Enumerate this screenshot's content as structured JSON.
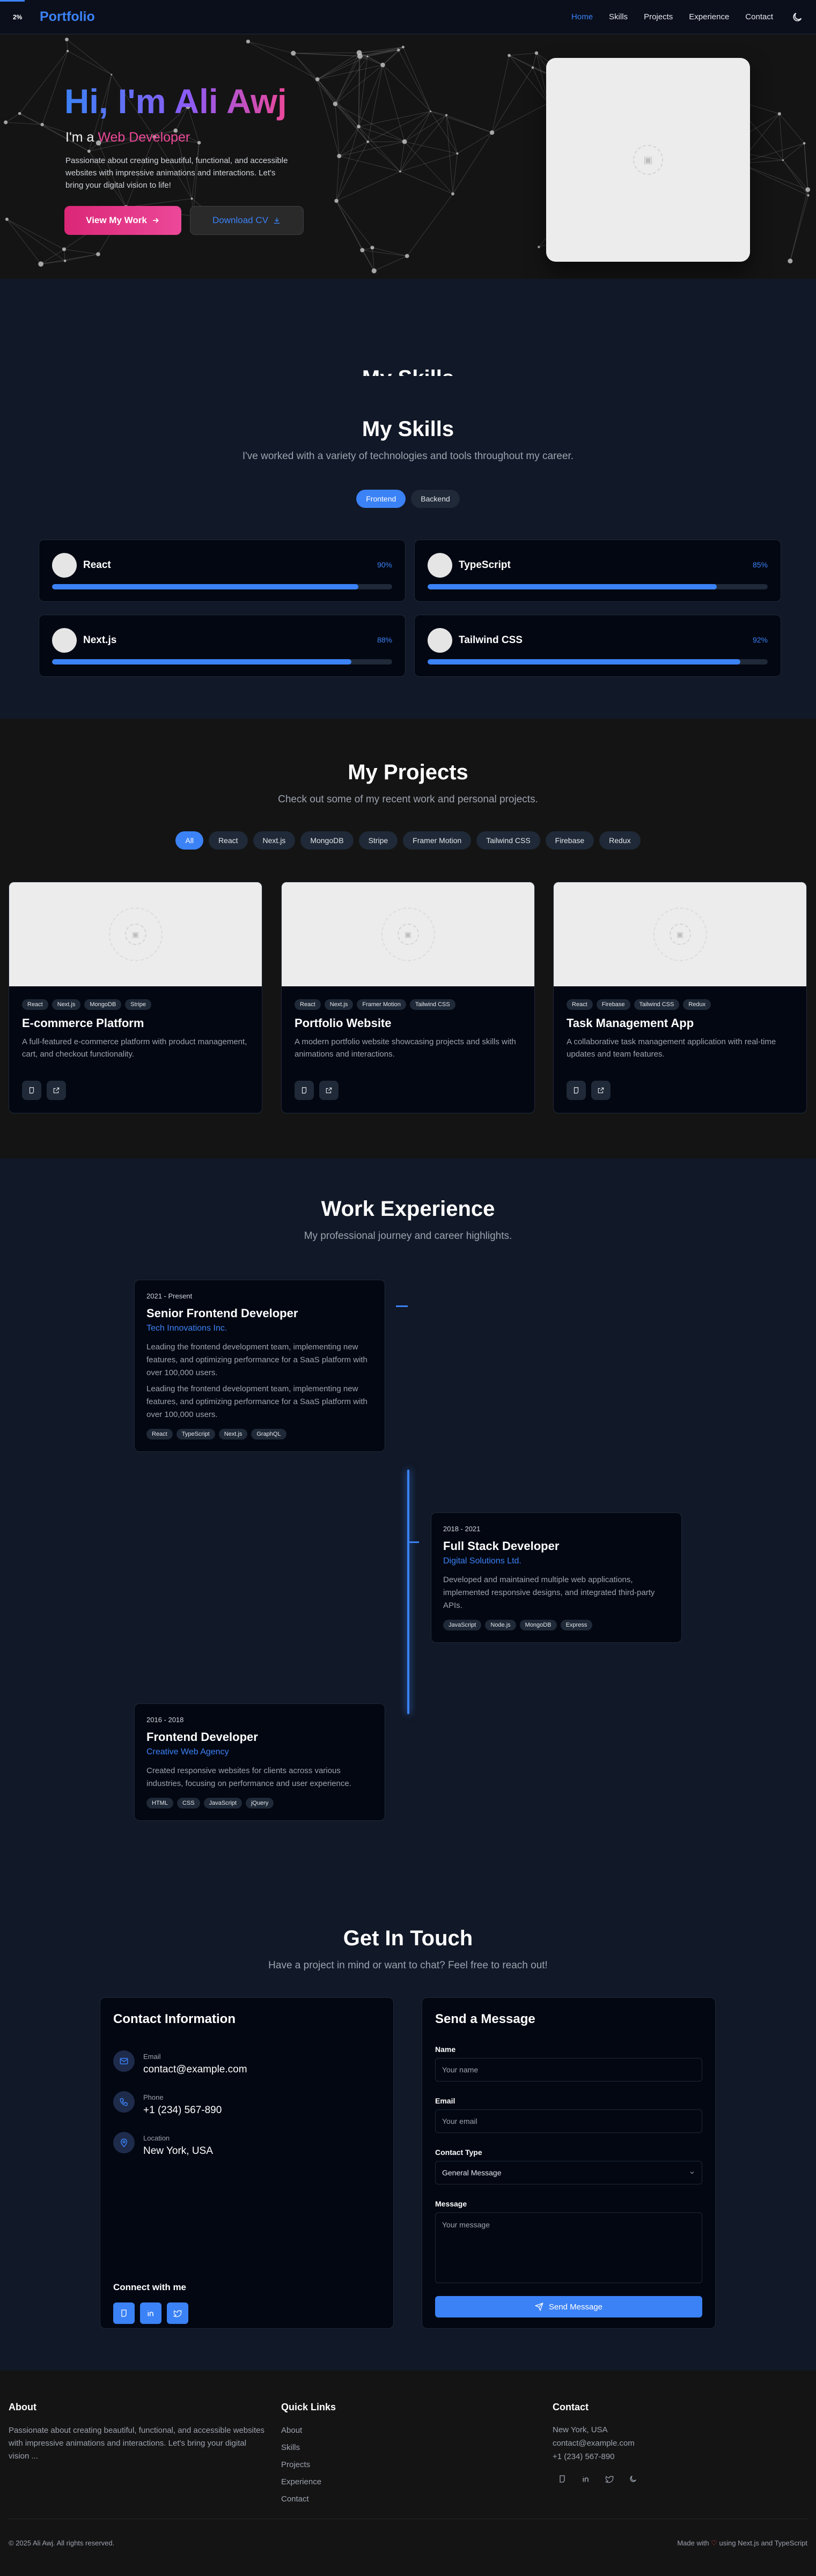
{
  "nav": {
    "scroll_percent": "2%",
    "brand": "Portfolio",
    "links": [
      "Home",
      "Skills",
      "Projects",
      "Experience",
      "Contact"
    ],
    "active": "Home"
  },
  "hero": {
    "title": "Hi, I'm Ali Awj",
    "role_prefix": "I'm a ",
    "role_highlight": "Web Developer",
    "description": "Passionate about creating beautiful, functional, and accessible websites with impressive animations and interactions. Let's bring your digital vision to life!",
    "primary_button": "View My Work",
    "secondary_button": "Download CV"
  },
  "skills": {
    "ghost_title": "My Skills",
    "title": "My Skills",
    "subtitle": "I've worked with a variety of technologies and tools throughout my career.",
    "tabs": [
      "Frontend",
      "Backend"
    ],
    "active_tab": "Frontend",
    "items": [
      {
        "name": "React",
        "percent_label": "90%",
        "level": 0.9
      },
      {
        "name": "TypeScript",
        "percent_label": "85%",
        "level": 0.85
      },
      {
        "name": "Next.js",
        "percent_label": "88%",
        "level": 0.88
      },
      {
        "name": "Tailwind CSS",
        "percent_label": "92%",
        "level": 0.92
      }
    ]
  },
  "projects": {
    "title": "My Projects",
    "subtitle": "Check out some of my recent work and personal projects.",
    "filters": [
      "All",
      "React",
      "Next.js",
      "MongoDB",
      "Stripe",
      "Framer Motion",
      "Tailwind CSS",
      "Firebase",
      "Redux"
    ],
    "active_filter": "All",
    "items": [
      {
        "tags": [
          "React",
          "Next.js",
          "MongoDB",
          "Stripe"
        ],
        "name": "E-commerce Platform",
        "description": "A full-featured e-commerce platform with product management, cart, and checkout functionality."
      },
      {
        "tags": [
          "React",
          "Next.js",
          "Framer Motion",
          "Tailwind CSS"
        ],
        "name": "Portfolio Website",
        "description": "A modern portfolio website showcasing projects and skills with animations and interactions."
      },
      {
        "tags": [
          "React",
          "Firebase",
          "Tailwind CSS",
          "Redux"
        ],
        "name": "Task Management App",
        "description": "A collaborative task management application with real-time updates and team features."
      }
    ]
  },
  "experience": {
    "title": "Work Experience",
    "subtitle": "My professional journey and career highlights.",
    "items": [
      {
        "period": "2021 - Present",
        "role": "Senior Frontend Developer",
        "company": "Tech Innovations Inc.",
        "paragraphs": [
          "Leading the frontend development team, implementing new features, and optimizing performance for a SaaS platform with over 100,000 users.",
          "Leading the frontend development team, implementing new features, and optimizing performance for a SaaS platform with over 100,000 users."
        ],
        "tags": [
          "React",
          "TypeScript",
          "Next.js",
          "GraphQL"
        ]
      },
      {
        "period": "2018 - 2021",
        "role": "Full Stack Developer",
        "company": "Digital Solutions Ltd.",
        "paragraphs": [
          "Developed and maintained multiple web applications, implemented responsive designs, and integrated third-party APIs."
        ],
        "tags": [
          "JavaScript",
          "Node.js",
          "MongoDB",
          "Express"
        ]
      },
      {
        "period": "2016 - 2018",
        "role": "Frontend Developer",
        "company": "Creative Web Agency",
        "paragraphs": [
          "Created responsive websites for clients across various industries, focusing on performance and user experience."
        ],
        "tags": [
          "HTML",
          "CSS",
          "JavaScript",
          "jQuery"
        ]
      }
    ]
  },
  "contact": {
    "title": "Get In Touch",
    "subtitle": "Have a project in mind or want to chat? Feel free to reach out!",
    "info_title": "Contact Information",
    "info": [
      {
        "label": "Email",
        "value": "contact@example.com",
        "icon": "mail-icon"
      },
      {
        "label": "Phone",
        "value": "+1 (234) 567-890",
        "icon": "phone-icon"
      },
      {
        "label": "Location",
        "value": "New York, USA",
        "icon": "map-pin-icon"
      }
    ],
    "connect_title": "Connect with me",
    "form_title": "Send a Message",
    "form": {
      "name_label": "Name",
      "name_placeholder": "Your name",
      "email_label": "Email",
      "email_placeholder": "Your email",
      "type_label": "Contact Type",
      "type_value": "General Message",
      "message_label": "Message",
      "message_placeholder": "Your message",
      "submit": "Send Message"
    }
  },
  "footer": {
    "about_title": "About",
    "about_text": "Passionate about creating beautiful, functional, and accessible websites with impressive animations and interactions. Let's bring your digital vision ...",
    "links_title": "Quick Links",
    "links": [
      "About",
      "Skills",
      "Projects",
      "Experience",
      "Contact"
    ],
    "contact_title": "Contact",
    "contact_lines": [
      "New York, USA",
      "contact@example.com",
      "+1 (234) 567-890"
    ],
    "copyright": "© 2025 Ali Awj. All rights reserved.",
    "made_prefix": "Made with",
    "made_suffix": "using Next.js and TypeScript"
  },
  "colors": {
    "accent": "#3b82f6",
    "pink": "#ec4899",
    "purple": "#8b5cf6",
    "heart": "#ef4444"
  }
}
